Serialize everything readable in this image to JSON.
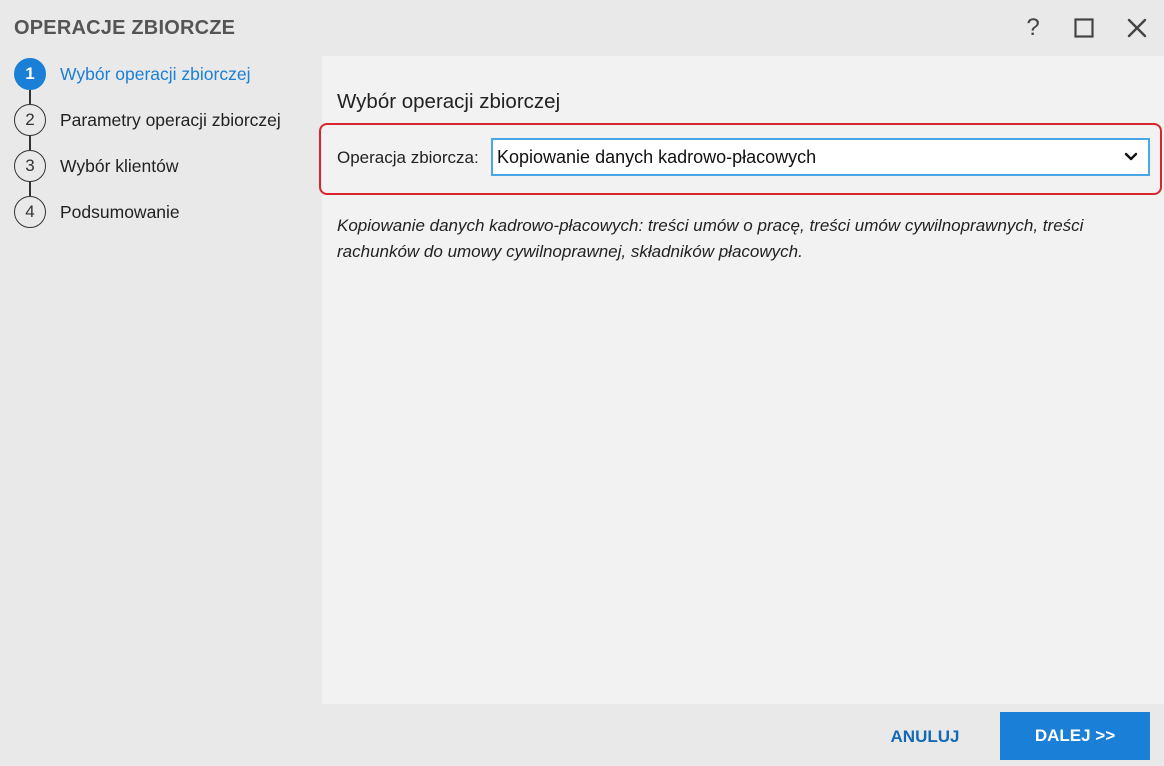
{
  "window": {
    "title": "OPERACJE ZBIORCZE",
    "help_glyph": "?"
  },
  "steps": [
    {
      "number": "1",
      "label": "Wybór operacji zbiorczej",
      "active": true
    },
    {
      "number": "2",
      "label": "Parametry operacji zbiorczej",
      "active": false
    },
    {
      "number": "3",
      "label": "Wybór klientów",
      "active": false
    },
    {
      "number": "4",
      "label": "Podsumowanie",
      "active": false
    }
  ],
  "content": {
    "title": "Wybór operacji zbiorczej",
    "operation_label": "Operacja zbiorcza:",
    "operation_value": "Kopiowanie danych kadrowo-płacowych",
    "description": "Kopiowanie danych kadrowo-płacowych: treści umów o pracę, treści umów cywilnoprawnych, treści rachunków do umowy cywilnoprawnej, składników płacowych."
  },
  "buttons": {
    "cancel": "ANULUJ",
    "next": "DALEJ >>"
  },
  "colors": {
    "accent": "#1a7fd6",
    "highlight": "#d9262c",
    "focus_border": "#4aa6e6"
  },
  "icons": {
    "help": "help-icon",
    "maximize": "maximize-icon",
    "close": "close-icon",
    "dropdown": "chevron-down-icon"
  }
}
